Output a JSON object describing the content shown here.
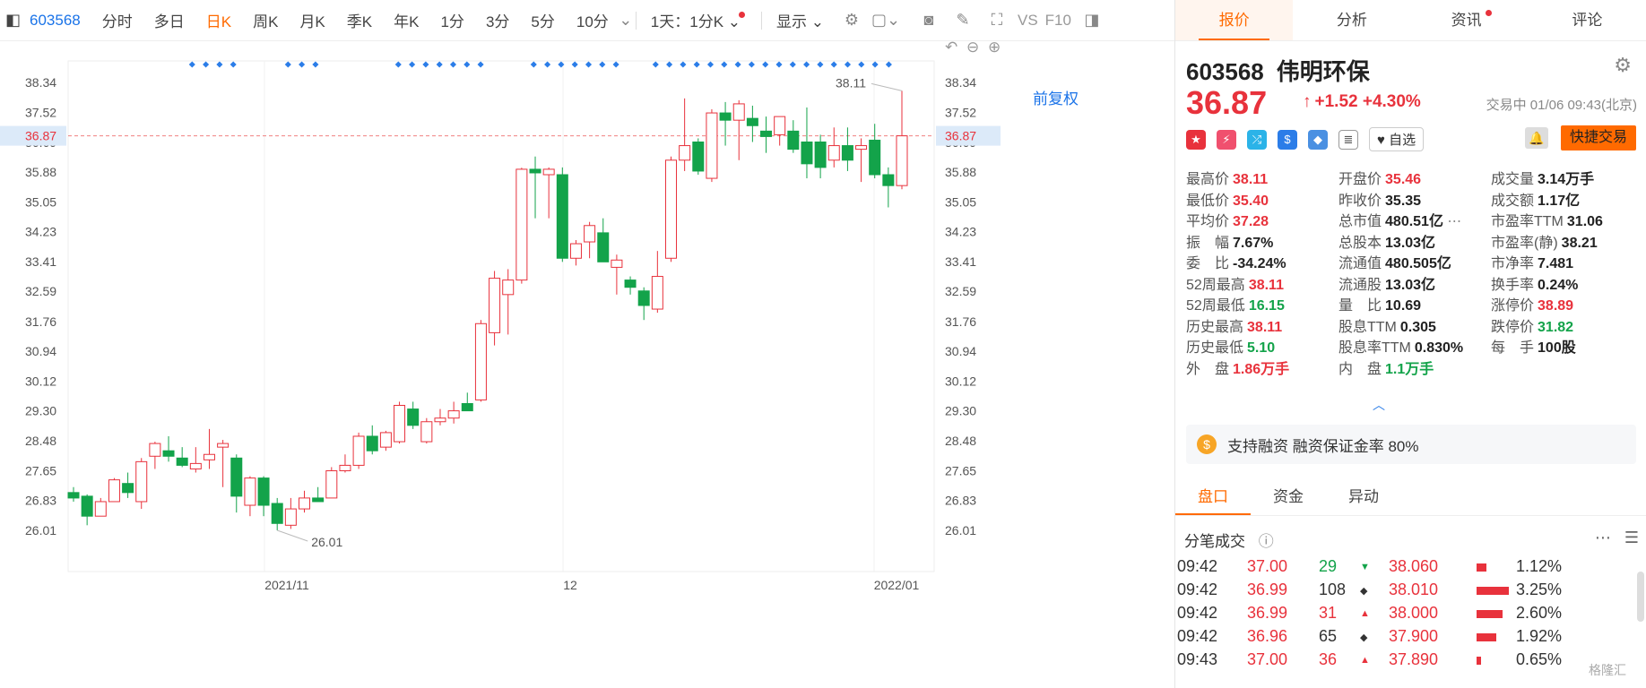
{
  "toolbar": {
    "code": "603568",
    "items": [
      "分时",
      "多日",
      "日K",
      "周K",
      "月K",
      "季K",
      "年K",
      "1分",
      "3分",
      "5分",
      "10分"
    ],
    "active_index": 2,
    "range": "1天：1分K",
    "display": "显示",
    "vs": "VS",
    "f10": "F10",
    "fuquan": "前复权"
  },
  "chart_data": {
    "type": "candlestick",
    "yticks": [
      "38.34",
      "37.52",
      "36.69",
      "35.88",
      "35.05",
      "34.23",
      "33.41",
      "32.59",
      "31.76",
      "30.94",
      "30.12",
      "29.30",
      "28.48",
      "27.65",
      "26.83",
      "26.01"
    ],
    "current_price_label": "36.87",
    "xticks": [
      "2021/11",
      "12",
      "2022/01"
    ],
    "annotations": {
      "high": "38.11",
      "low": "26.01"
    },
    "candles": [
      {
        "o": 27.05,
        "h": 27.2,
        "l": 26.8,
        "c": 26.9
      },
      {
        "o": 26.95,
        "h": 27.0,
        "l": 26.15,
        "c": 26.4
      },
      {
        "o": 26.4,
        "h": 26.9,
        "l": 26.4,
        "c": 26.8
      },
      {
        "o": 26.8,
        "h": 27.45,
        "l": 26.8,
        "c": 27.4
      },
      {
        "o": 27.3,
        "h": 27.6,
        "l": 26.9,
        "c": 27.05
      },
      {
        "o": 26.8,
        "h": 28.0,
        "l": 26.6,
        "c": 27.9
      },
      {
        "o": 28.05,
        "h": 28.45,
        "l": 27.7,
        "c": 28.4
      },
      {
        "o": 28.2,
        "h": 28.6,
        "l": 27.9,
        "c": 28.05
      },
      {
        "o": 28.0,
        "h": 28.3,
        "l": 27.75,
        "c": 27.8
      },
      {
        "o": 27.7,
        "h": 28.3,
        "l": 27.6,
        "c": 27.85
      },
      {
        "o": 27.95,
        "h": 28.8,
        "l": 27.7,
        "c": 28.1
      },
      {
        "o": 28.3,
        "h": 28.5,
        "l": 27.2,
        "c": 28.4
      },
      {
        "o": 28.0,
        "h": 28.1,
        "l": 26.5,
        "c": 26.95
      },
      {
        "o": 26.7,
        "h": 27.5,
        "l": 26.4,
        "c": 27.45
      },
      {
        "o": 27.45,
        "h": 27.5,
        "l": 26.4,
        "c": 26.7
      },
      {
        "o": 26.75,
        "h": 26.9,
        "l": 26.01,
        "c": 26.2
      },
      {
        "o": 26.15,
        "h": 26.9,
        "l": 26.05,
        "c": 26.6
      },
      {
        "o": 26.6,
        "h": 27.1,
        "l": 26.5,
        "c": 26.9
      },
      {
        "o": 26.9,
        "h": 27.2,
        "l": 26.8,
        "c": 26.8
      },
      {
        "o": 26.9,
        "h": 27.75,
        "l": 26.9,
        "c": 27.65
      },
      {
        "o": 27.65,
        "h": 28.1,
        "l": 27.6,
        "c": 27.8
      },
      {
        "o": 27.8,
        "h": 28.7,
        "l": 27.7,
        "c": 28.6
      },
      {
        "o": 28.6,
        "h": 28.9,
        "l": 28.1,
        "c": 28.2
      },
      {
        "o": 28.3,
        "h": 28.75,
        "l": 28.2,
        "c": 28.7
      },
      {
        "o": 28.45,
        "h": 29.55,
        "l": 28.4,
        "c": 29.45
      },
      {
        "o": 29.35,
        "h": 29.55,
        "l": 28.8,
        "c": 28.9
      },
      {
        "o": 28.45,
        "h": 29.1,
        "l": 28.4,
        "c": 29.0
      },
      {
        "o": 29.0,
        "h": 29.35,
        "l": 28.9,
        "c": 29.1
      },
      {
        "o": 29.1,
        "h": 29.55,
        "l": 28.95,
        "c": 29.3
      },
      {
        "o": 29.5,
        "h": 29.8,
        "l": 29.3,
        "c": 29.3
      },
      {
        "o": 29.6,
        "h": 31.8,
        "l": 29.55,
        "c": 31.7
      },
      {
        "o": 31.45,
        "h": 33.15,
        "l": 31.1,
        "c": 32.95
      },
      {
        "o": 32.5,
        "h": 33.2,
        "l": 31.4,
        "c": 32.9
      },
      {
        "o": 32.9,
        "h": 35.99,
        "l": 32.8,
        "c": 35.95
      },
      {
        "o": 35.95,
        "h": 36.3,
        "l": 34.6,
        "c": 35.85
      },
      {
        "o": 35.8,
        "h": 36.0,
        "l": 34.6,
        "c": 35.95
      },
      {
        "o": 35.8,
        "h": 36.0,
        "l": 33.4,
        "c": 33.5
      },
      {
        "o": 33.5,
        "h": 34.0,
        "l": 33.3,
        "c": 33.9
      },
      {
        "o": 33.95,
        "h": 34.5,
        "l": 33.5,
        "c": 34.4
      },
      {
        "o": 34.2,
        "h": 34.6,
        "l": 33.4,
        "c": 33.4
      },
      {
        "o": 33.25,
        "h": 33.6,
        "l": 32.5,
        "c": 33.45
      },
      {
        "o": 32.9,
        "h": 33.0,
        "l": 32.5,
        "c": 32.7
      },
      {
        "o": 32.6,
        "h": 32.7,
        "l": 31.8,
        "c": 32.2
      },
      {
        "o": 32.1,
        "h": 33.7,
        "l": 32.0,
        "c": 33.0
      },
      {
        "o": 33.5,
        "h": 36.3,
        "l": 33.4,
        "c": 36.2
      },
      {
        "o": 36.2,
        "h": 37.9,
        "l": 35.9,
        "c": 36.6
      },
      {
        "o": 36.7,
        "h": 36.8,
        "l": 35.8,
        "c": 35.9
      },
      {
        "o": 35.7,
        "h": 37.6,
        "l": 35.6,
        "c": 37.5
      },
      {
        "o": 37.5,
        "h": 37.8,
        "l": 36.6,
        "c": 37.3
      },
      {
        "o": 37.3,
        "h": 37.85,
        "l": 36.2,
        "c": 37.75
      },
      {
        "o": 37.35,
        "h": 37.7,
        "l": 36.7,
        "c": 37.15
      },
      {
        "o": 37.0,
        "h": 37.4,
        "l": 36.4,
        "c": 36.85
      },
      {
        "o": 36.9,
        "h": 37.4,
        "l": 36.6,
        "c": 37.4
      },
      {
        "o": 37.0,
        "h": 37.3,
        "l": 36.4,
        "c": 36.5
      },
      {
        "o": 36.7,
        "h": 37.65,
        "l": 35.7,
        "c": 36.1
      },
      {
        "o": 36.7,
        "h": 36.9,
        "l": 35.7,
        "c": 36.0
      },
      {
        "o": 36.2,
        "h": 37.1,
        "l": 36.0,
        "c": 36.6
      },
      {
        "o": 36.6,
        "h": 37.1,
        "l": 35.9,
        "c": 36.2
      },
      {
        "o": 36.5,
        "h": 36.8,
        "l": 35.6,
        "c": 36.6
      },
      {
        "o": 36.75,
        "h": 37.2,
        "l": 35.7,
        "c": 35.8
      },
      {
        "o": 35.8,
        "h": 36.0,
        "l": 34.9,
        "c": 35.5
      },
      {
        "o": 35.5,
        "h": 38.11,
        "l": 35.4,
        "c": 36.87
      }
    ],
    "dots_groups": [
      [
        215,
        262
      ],
      [
        322,
        354
      ],
      [
        445,
        537
      ],
      [
        596,
        688
      ],
      [
        732,
        1006
      ]
    ]
  },
  "panel": {
    "tabs": [
      "报价",
      "分析",
      "资讯",
      "评论"
    ],
    "code": "603568",
    "name": "伟明环保",
    "price": "36.87",
    "arrow": "↑",
    "change": "+1.52",
    "change_pct": "+4.30%",
    "status": "交易中 01/06 09:43(北京)",
    "zixuan": "自选",
    "quick_trade": "快捷交易",
    "stats": [
      [
        [
          "最高价",
          "38.11",
          "red"
        ],
        [
          "开盘价",
          "35.46",
          "red"
        ],
        [
          "成交量",
          "3.14万手",
          "dark"
        ]
      ],
      [
        [
          "最低价",
          "35.40",
          "red"
        ],
        [
          "昨收价",
          "35.35",
          "dark"
        ],
        [
          "成交额",
          "1.17亿",
          "dark"
        ]
      ],
      [
        [
          "平均价",
          "37.28",
          "red"
        ],
        [
          "总市值",
          "480.51亿",
          "dark"
        ],
        [
          "市盈率TTM",
          "31.06",
          "dark"
        ]
      ],
      [
        [
          "振　幅",
          "7.67%",
          "dark"
        ],
        [
          "总股本",
          "13.03亿",
          "dark"
        ],
        [
          "市盈率(静)",
          "38.21",
          "dark"
        ]
      ],
      [
        [
          "委　比",
          "-34.24%",
          "dark"
        ],
        [
          "流通值",
          "480.505亿",
          "dark"
        ],
        [
          "市净率",
          "7.481",
          "dark"
        ]
      ],
      [
        [
          "52周最高",
          "38.11",
          "red"
        ],
        [
          "流通股",
          "13.03亿",
          "dark"
        ],
        [
          "换手率",
          "0.24%",
          "dark"
        ]
      ],
      [
        [
          "52周最低",
          "16.15",
          "green"
        ],
        [
          "量　比",
          "10.69",
          "dark"
        ],
        [
          "涨停价",
          "38.89",
          "red"
        ]
      ],
      [
        [
          "历史最高",
          "38.11",
          "red"
        ],
        [
          "股息TTM",
          "0.305",
          "dark"
        ],
        [
          "跌停价",
          "31.82",
          "green"
        ]
      ],
      [
        [
          "历史最低",
          "5.10",
          "green"
        ],
        [
          "股息率TTM",
          "0.830%",
          "dark"
        ],
        [
          "每　手",
          "100股",
          "dark"
        ]
      ],
      [
        [
          "外　盘",
          "1.86万手",
          "red"
        ],
        [
          "内　盘",
          "1.1万手",
          "green"
        ],
        [
          "",
          "",
          " "
        ]
      ]
    ],
    "banner": "支持融资 融资保证金率 80%",
    "subtabs": [
      "盘口",
      "资金",
      "异动"
    ],
    "tick_title": "分笔成交",
    "ticks": [
      {
        "time": "09:42",
        "price": "37.00",
        "pc": "red",
        "vol": "29",
        "vc": "green",
        "dir": "▼",
        "lvl": "38.060",
        "pct": "1.12%",
        "bar": 0.3
      },
      {
        "time": "09:42",
        "price": "36.99",
        "pc": "red",
        "vol": "108",
        "vc": "dark",
        "dir": "◆",
        "lvl": "38.010",
        "pct": "3.25%",
        "bar": 1.0
      },
      {
        "time": "09:42",
        "price": "36.99",
        "pc": "red",
        "vol": "31",
        "vc": "red",
        "dir": "▲",
        "lvl": "38.000",
        "pct": "2.60%",
        "bar": 0.8
      },
      {
        "time": "09:42",
        "price": "36.96",
        "pc": "red",
        "vol": "65",
        "vc": "dark",
        "dir": "◆",
        "lvl": "37.900",
        "pct": "1.92%",
        "bar": 0.6
      },
      {
        "time": "09:43",
        "price": "37.00",
        "pc": "red",
        "vol": "36",
        "vc": "red",
        "dir": "▲",
        "lvl": "37.890",
        "pct": "0.65%",
        "bar": 0.15
      }
    ],
    "watermark": "格隆汇"
  }
}
